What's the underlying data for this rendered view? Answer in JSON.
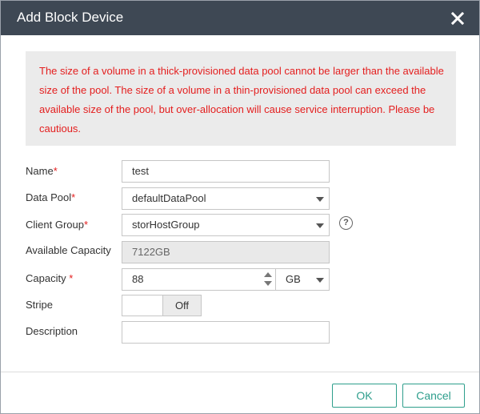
{
  "dialog": {
    "title": "Add Block Device",
    "close_icon": "close-x-icon"
  },
  "warning": {
    "text": "The size of a volume in a thick-provisioned data pool cannot be larger than the available size of the pool. The size of a volume in a thin-provisioned data pool can exceed the available size of the pool, but over-allocation will cause service interruption. Please be cautious."
  },
  "form": {
    "name": {
      "label": "Name",
      "required_mark": "*",
      "value": "test"
    },
    "data_pool": {
      "label": "Data Pool",
      "required_mark": "*",
      "value": "defaultDataPool"
    },
    "client_group": {
      "label": "Client Group",
      "required_mark": "*",
      "value": "storHostGroup",
      "help_icon": "question-circle-icon",
      "help_text": "?"
    },
    "available_capacity": {
      "label": "Available Capacity",
      "value": "7122GB"
    },
    "capacity": {
      "label": "Capacity ",
      "required_mark": "*",
      "value": "88",
      "unit": "GB"
    },
    "stripe": {
      "label": "Stripe",
      "state_label": "Off"
    },
    "description": {
      "label": "Description",
      "value": ""
    }
  },
  "footer": {
    "ok_label": "OK",
    "cancel_label": "Cancel"
  },
  "colors": {
    "titlebar": "#3e4854",
    "warning_text": "#e41e1e",
    "warning_bg": "#ebebeb",
    "button_accent": "#2e9e8c"
  }
}
